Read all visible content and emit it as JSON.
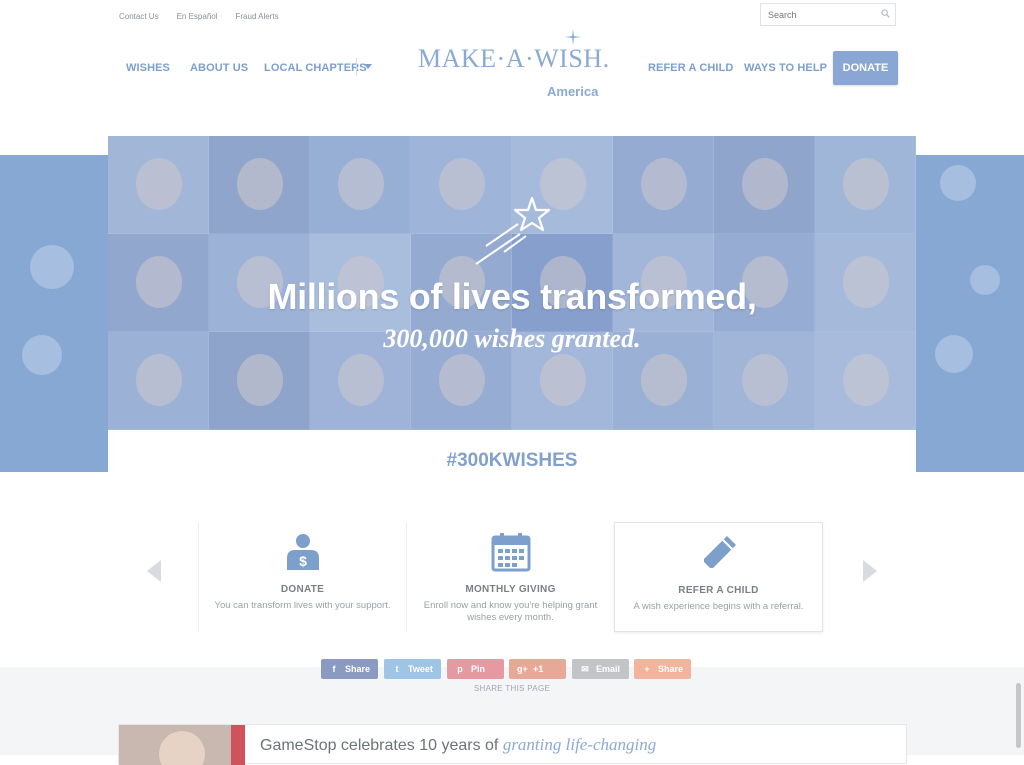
{
  "utility_nav": [
    "Contact Us",
    "En Español",
    "Fraud Alerts"
  ],
  "search": {
    "placeholder": "Search"
  },
  "nav_left": [
    "WISHES",
    "ABOUT US",
    "LOCAL CHAPTERS"
  ],
  "nav_right": [
    "REFER A CHILD",
    "WAYS TO HELP"
  ],
  "donate_button": "DONATE",
  "logo": {
    "main": "MAKE·A·WISH.",
    "sub": "America"
  },
  "hero": {
    "headline": "Millions of lives transformed,",
    "subheadline": "300,000 wishes granted.",
    "hashtag": "#300KWISHES"
  },
  "cards": [
    {
      "title": "DONATE",
      "desc": "You can transform lives with your support.",
      "icon": "person-dollar-icon"
    },
    {
      "title": "MONTHLY GIVING",
      "desc": "Enroll now and know you're helping grant wishes every month.",
      "icon": "calendar-icon"
    },
    {
      "title": "REFER A CHILD",
      "desc": "A wish experience begins with a referral.",
      "icon": "pencil-icon"
    }
  ],
  "share_buttons": [
    {
      "label": "Share",
      "icon": "f",
      "color": "#8a9ac0"
    },
    {
      "label": "Tweet",
      "icon": "t",
      "color": "#9ec4e6"
    },
    {
      "label": "Pin",
      "icon": "p",
      "color": "#e49aa0"
    },
    {
      "label": "+1",
      "icon": "g+",
      "color": "#e8a898"
    },
    {
      "label": "Email",
      "icon": "✉",
      "color": "#c2c4c8"
    },
    {
      "label": "Share",
      "icon": "+",
      "color": "#f2b49c"
    }
  ],
  "share_label": "SHARE THIS PAGE",
  "story": {
    "text": "GameStop celebrates 10 years of",
    "emphasis": "granting life-changing"
  }
}
